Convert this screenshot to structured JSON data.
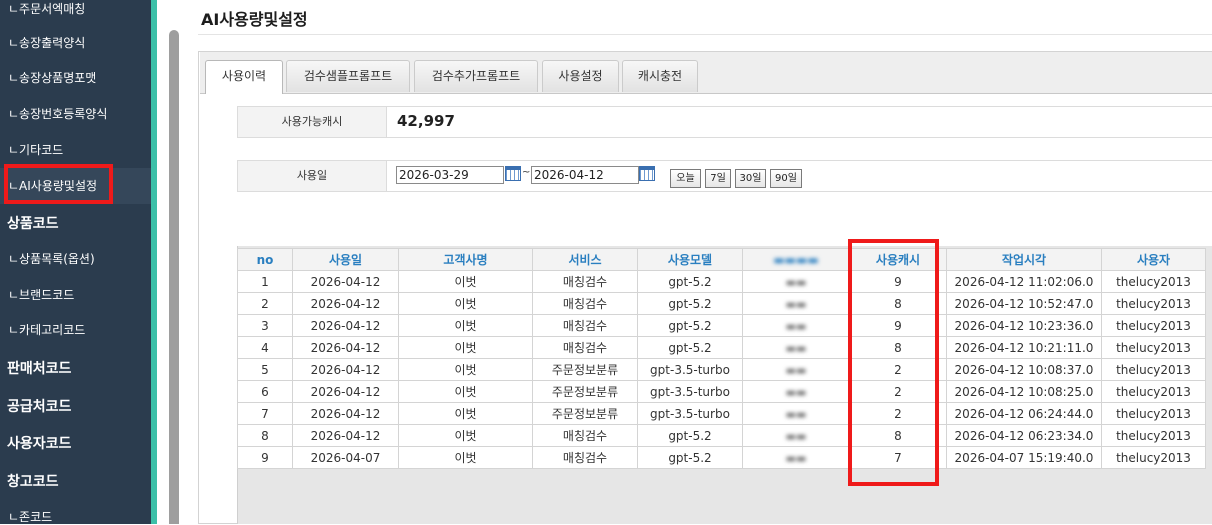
{
  "sidebar": {
    "items": [
      {
        "label": "ㄴ주문서엑매칭",
        "kind": "sub"
      },
      {
        "label": "ㄴ송장출력양식",
        "kind": "sub"
      },
      {
        "label": "ㄴ송장상품명포맷",
        "kind": "sub"
      },
      {
        "label": "ㄴ송장번호등록양식",
        "kind": "sub"
      },
      {
        "label": "ㄴ기타코드",
        "kind": "sub"
      },
      {
        "label": "ㄴAI사용량및설정",
        "kind": "sub-active"
      },
      {
        "label": "상품코드",
        "kind": "head"
      },
      {
        "label": "ㄴ상품목록(옵션)",
        "kind": "sub"
      },
      {
        "label": "ㄴ브랜드코드",
        "kind": "sub"
      },
      {
        "label": "ㄴ카테고리코드",
        "kind": "sub"
      },
      {
        "label": "판매처코드",
        "kind": "head"
      },
      {
        "label": "공급처코드",
        "kind": "head"
      },
      {
        "label": "사용자코드",
        "kind": "head"
      },
      {
        "label": "창고코드",
        "kind": "head"
      },
      {
        "label": "ㄴ존코드",
        "kind": "sub"
      }
    ]
  },
  "page": {
    "title": "AI사용량및설정"
  },
  "tabs": [
    {
      "label": "사용이력",
      "active": true
    },
    {
      "label": "검수샘플프롬프트",
      "active": false
    },
    {
      "label": "검수추가프롬프트",
      "active": false
    },
    {
      "label": "사용설정",
      "active": false
    },
    {
      "label": "캐시충전",
      "active": false
    }
  ],
  "cash": {
    "label": "사용가능캐시",
    "value": "42,997"
  },
  "date_filter": {
    "label": "사용일",
    "start": "2026-03-29",
    "end": "2026-04-12",
    "separator": "~",
    "buttons": [
      "오늘",
      "7일",
      "30일",
      "90일"
    ]
  },
  "table": {
    "headers": [
      "no",
      "사용일",
      "고객사명",
      "서비스",
      "사용모델",
      "(blurred)",
      "사용캐시",
      "작업시각",
      "사용자"
    ],
    "rows": [
      [
        "1",
        "2026-04-12",
        "이벗",
        "매칭검수",
        "gpt-5.2",
        "(blurred)",
        "9",
        "2026-04-12 11:02:06.0",
        "thelucy2013"
      ],
      [
        "2",
        "2026-04-12",
        "이벗",
        "매칭검수",
        "gpt-5.2",
        "(blurred)",
        "8",
        "2026-04-12 10:52:47.0",
        "thelucy2013"
      ],
      [
        "3",
        "2026-04-12",
        "이벗",
        "매칭검수",
        "gpt-5.2",
        "(blurred)",
        "9",
        "2026-04-12 10:23:36.0",
        "thelucy2013"
      ],
      [
        "4",
        "2026-04-12",
        "이벗",
        "매칭검수",
        "gpt-5.2",
        "(blurred)",
        "8",
        "2026-04-12 10:21:11.0",
        "thelucy2013"
      ],
      [
        "5",
        "2026-04-12",
        "이벗",
        "주문정보분류",
        "gpt-3.5-turbo",
        "(blurred)",
        "2",
        "2026-04-12 10:08:37.0",
        "thelucy2013"
      ],
      [
        "6",
        "2026-04-12",
        "이벗",
        "주문정보분류",
        "gpt-3.5-turbo",
        "(blurred)",
        "2",
        "2026-04-12 10:08:25.0",
        "thelucy2013"
      ],
      [
        "7",
        "2026-04-12",
        "이벗",
        "주문정보분류",
        "gpt-3.5-turbo",
        "(blurred)",
        "2",
        "2026-04-12 06:24:44.0",
        "thelucy2013"
      ],
      [
        "8",
        "2026-04-12",
        "이벗",
        "매칭검수",
        "gpt-5.2",
        "(blurred)",
        "8",
        "2026-04-12 06:23:34.0",
        "thelucy2013"
      ],
      [
        "9",
        "2026-04-07",
        "이벗",
        "매칭검수",
        "gpt-5.2",
        "(blurred)",
        "7",
        "2026-04-07 15:19:40.0",
        "thelucy2013"
      ]
    ]
  },
  "colors": {
    "sidebar": "#2b3c4e",
    "accent": "#3cc0a8",
    "highlight": "#ef1a1a",
    "header_text": "#2a7fc0"
  },
  "icons": [
    "calendar-icon"
  ]
}
